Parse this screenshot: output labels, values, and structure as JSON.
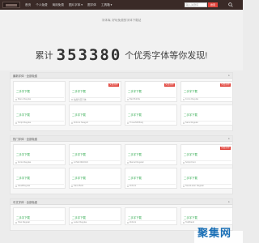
{
  "header": {
    "nav": [
      "首页",
      "个人免费",
      "商用免费",
      "图片字体 ▾",
      "图字体",
      "工具箱 ▾"
    ],
    "search_placeholder": "输入关键词",
    "search_button": "搜索"
  },
  "banner": {
    "subtitle": "字体库, 好玩免费的字体下载站",
    "count_prefix": "累计",
    "count_value": "353380",
    "count_suffix": "个优秀字体等你发现!"
  },
  "sections": [
    {
      "title": "最新字体 · 全部免费",
      "more": "▸",
      "cards": [
        {
          "label": "二手字下载",
          "badge": "",
          "foot": "Manu Regular"
        },
        {
          "label": "二手字下载",
          "badge": "免费商用",
          "foot": "站酷仓耳字体"
        },
        {
          "label": "二手字下载",
          "badge": "免费商用",
          "foot": "Bad Bubble"
        },
        {
          "label": "二手字下载",
          "badge": "免费商用",
          "foot": "Fonts Regular"
        },
        {
          "label": "二手字下载",
          "badge": "",
          "foot": "Script Regular"
        },
        {
          "label": "二手字下载",
          "badge": "",
          "foot": "ZnFont Seagull"
        },
        {
          "label": "二手字下载",
          "badge": "",
          "foot": "TimesNR Body"
        },
        {
          "label": "二手字下载",
          "badge": "",
          "foot": "Sans Regular"
        }
      ]
    },
    {
      "title": "热门字体 · 全部免费",
      "more": "▸",
      "cards": [
        {
          "label": "二手字下载",
          "badge": "",
          "foot": "Fonts Regular"
        },
        {
          "label": "二手字下载",
          "badge": "",
          "foot": "LOVE DESIGN"
        },
        {
          "label": "二手字下载",
          "badge": "",
          "foot": "Marvel Regular"
        },
        {
          "label": "二手字下载",
          "badge": "免费商用",
          "foot": "Script Font"
        },
        {
          "label": "二手字下载",
          "badge": "",
          "foot": "HeadRegular"
        },
        {
          "label": "二手字下载",
          "badge": "",
          "foot": "Sans Bold"
        },
        {
          "label": "二手字下载",
          "badge": "",
          "foot": "ZnFont"
        },
        {
          "label": "二手字下载",
          "badge": "",
          "foot": "NewsLetter Regular"
        }
      ]
    },
    {
      "title": "中文字体 · 全部免费",
      "more": "▸",
      "cards": [
        {
          "label": "二手字下载",
          "badge": "",
          "foot": "SGo Regular"
        },
        {
          "label": "二手字下载",
          "badge": "",
          "foot": "Letter Regular"
        },
        {
          "label": "二手字下载",
          "badge": "",
          "foot": "ZnFont"
        },
        {
          "label": "二手字下载",
          "badge": "",
          "foot": "TopBrand"
        }
      ]
    }
  ],
  "watermark": "聚集网"
}
